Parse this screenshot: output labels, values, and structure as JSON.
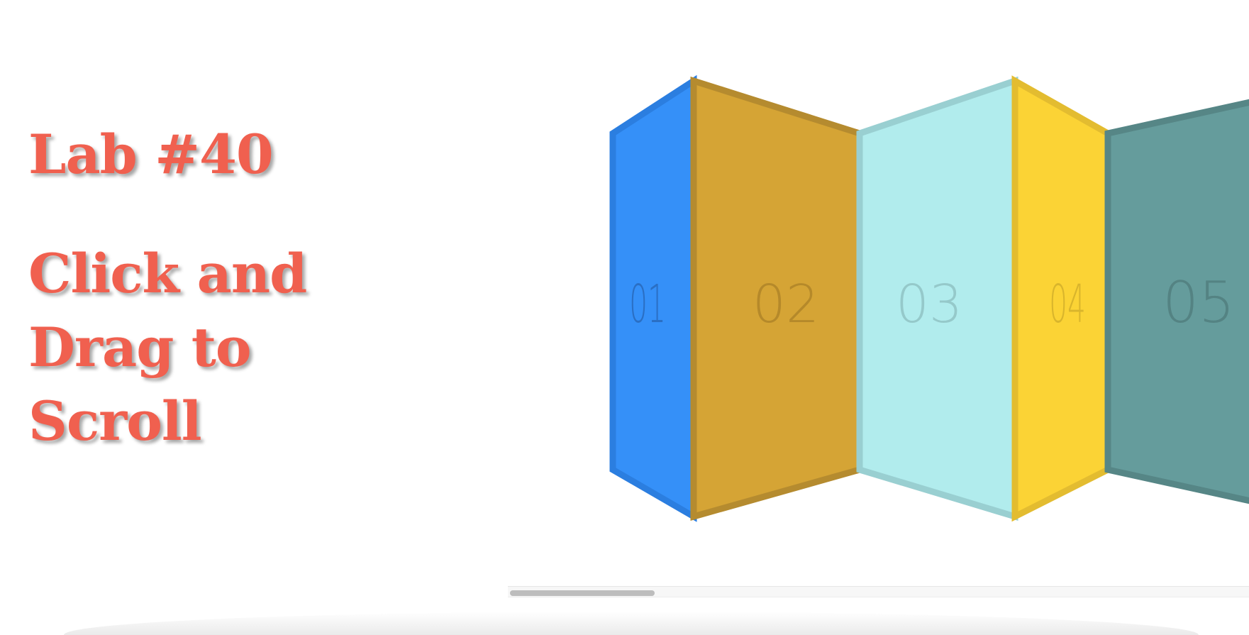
{
  "title": "Lab #40",
  "instructions": [
    "Click and",
    "Drag to",
    "Scroll"
  ],
  "panels": [
    {
      "number": "01",
      "fill": "#3590f8",
      "border": "#2b7ee0",
      "text": "#2a6fc4"
    },
    {
      "number": "02",
      "fill": "#d5a435",
      "border": "#b58b2f",
      "text": "#b5892a"
    },
    {
      "number": "03",
      "fill": "#b1eced",
      "border": "#99cfd1",
      "text": "#95c9ca"
    },
    {
      "number": "04",
      "fill": "#fbd335",
      "border": "#e3bc30",
      "text": "#d9b52c"
    },
    {
      "number": "05",
      "fill": "#659c9c",
      "border": "#568686",
      "text": "#548383"
    }
  ],
  "colors": {
    "title": "#f0604f",
    "background": "#ffffff"
  }
}
